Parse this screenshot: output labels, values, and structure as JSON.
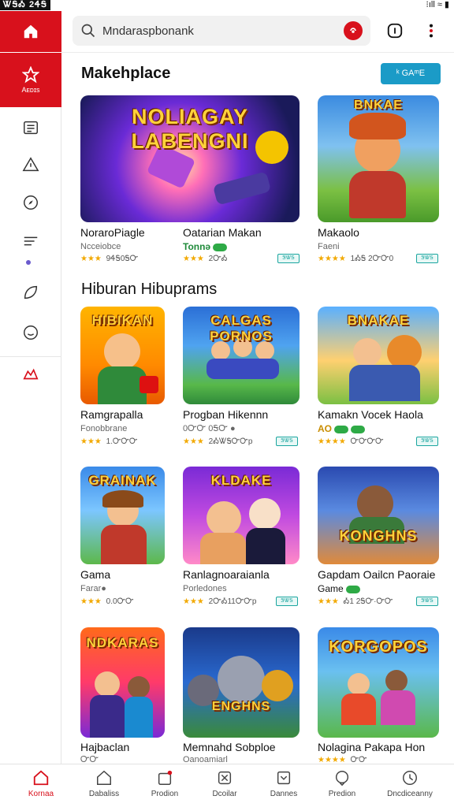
{
  "status_bar": {
    "time": "ᏔᎦᎣ 2ᏎᎦ",
    "system_icons": "⁝ıll ≈ ▮"
  },
  "rail": {
    "active_label": "Aᴇᴅɪs",
    "items": [
      "list-icon",
      "alert-icon",
      "compass-icon",
      "sliders-icon",
      "leaf-icon",
      "smile-icon",
      "group-icon"
    ]
  },
  "search": {
    "query": "Mndaraspbonank"
  },
  "marketplace": {
    "title": "Makehplace",
    "button_label": "ᵏ GAᵐE",
    "items": [
      {
        "thumb_title": "NOLIAGAY LABENGNI",
        "name": "NoraroPiagle",
        "sub": "Ncceiobce",
        "meta": "★★★ 9ᏎᎦ0ᎦᏅ"
      },
      {
        "name": "Oatarian Makan",
        "sub": "Tonnə",
        "meta": "★★★ 2ᏅᎣ",
        "tag": "ᏕᏔᎦ"
      },
      {
        "thumb_title": "BNKAE",
        "name": "Makaolo",
        "sub": "Faeni",
        "meta": "★★★★ 1ᎣᎦ 2ᏅᏅ0",
        "tag": "ᏕᏔᎦ"
      }
    ]
  },
  "hiburan": {
    "title": "Hiburan Hibuprams",
    "rows": [
      [
        {
          "thumb_title": "HIBIKAN",
          "name": "Ramgrapalla",
          "sub": "Fonobbrane",
          "meta": "★★★ 1.ᏅᏅᏅ"
        },
        {
          "thumb_title": "CALGAS PORNOS",
          "name": "Progban Hikennn",
          "sub": "0ᏅᏅ 0ᎦᏅ ●",
          "meta": "★★★ 2ᎣᏔᎦᏅᏅp",
          "tag": "ᏕᏔᎦ"
        },
        {
          "thumb_title": "BNAKAE",
          "name": "Kamakn Vocek Haola",
          "sub": "AO",
          "meta": "★★★★ ᏅᏅᏅᏅ",
          "tag": "ᏕᏔᎦ"
        }
      ],
      [
        {
          "thumb_title": "GRAINAK",
          "name": "Gama",
          "sub": "Farar●",
          "meta": "★★★ 0.0ᏅᏅ"
        },
        {
          "thumb_title": "KLDAKE",
          "name": "Ranlagnoaraianla",
          "sub": "Porledones",
          "meta": "★★★ 2ᏅᎣ11ᏅᏅp",
          "tag": "ᏕᏔᎦ"
        },
        {
          "thumb_title": "KONGHNS",
          "name": "Gapdam Oailcn Paoraie",
          "sub": "Game",
          "meta": "★★★ Ꭳ1 2ᎦᏅ·ᏅᏅ",
          "tag": "ᏕᏔᎦ"
        }
      ],
      [
        {
          "thumb_title": "NDKARAS",
          "name": "Hajbaclan",
          "sub": "ᏅᏅ",
          "meta": ""
        },
        {
          "thumb_title": "ENGHNS",
          "name": "Memnahd Sobploe",
          "sub": "Oanoamiarl",
          "meta": ""
        },
        {
          "thumb_title": "KORGOPOS",
          "name": "Nolagina Pakapa Hon",
          "sub": "",
          "meta": "★★★★ ᏅᏅ"
        }
      ]
    ]
  },
  "bottom_nav": [
    {
      "label": "Kornaa",
      "icon": "home-icon",
      "active": true
    },
    {
      "label": "Dabaliss",
      "icon": "house-outline-icon"
    },
    {
      "label": "Prodion",
      "icon": "bag-icon"
    },
    {
      "label": "Dcoilar",
      "icon": "cart-icon"
    },
    {
      "label": "Dannes",
      "icon": "check-box-icon"
    },
    {
      "label": "Predion",
      "icon": "chat-icon"
    },
    {
      "label": "Dncdiceanny",
      "icon": "clock-icon"
    }
  ],
  "colors": {
    "brand_red": "#d8111c",
    "button_blue": "#1b9bc7",
    "star_gold": "#f2a900",
    "tag_teal": "#1ba6a0"
  }
}
